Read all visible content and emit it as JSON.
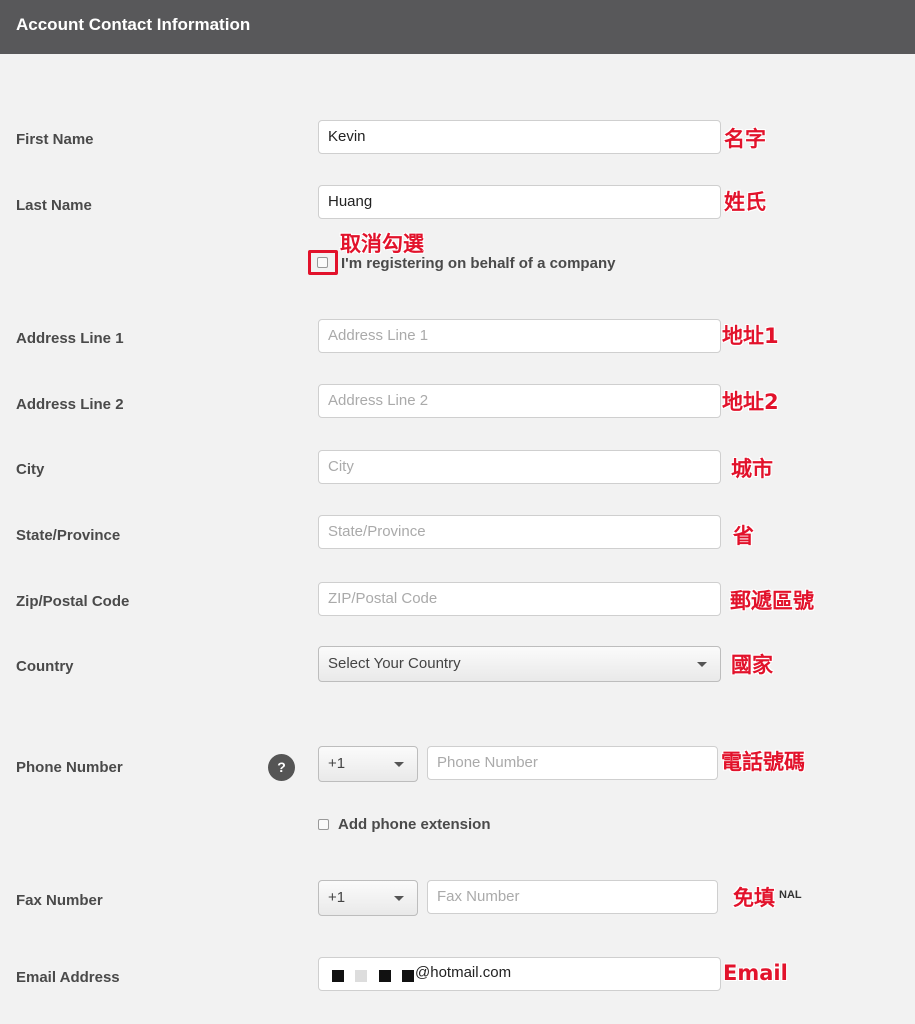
{
  "header": {
    "title": "Account Contact Information"
  },
  "fields": {
    "first_name": {
      "label": "First Name",
      "value": "Kevin",
      "annotation": "名字"
    },
    "last_name": {
      "label": "Last Name",
      "value": "Huang",
      "annotation": "姓氏"
    },
    "company_checkbox": {
      "label": "I'm registering on behalf of a company",
      "annotation": "取消勾選",
      "checked": false
    },
    "address1": {
      "label": "Address Line 1",
      "placeholder": "Address Line 1",
      "annotation": "地址1"
    },
    "address2": {
      "label": "Address Line 2",
      "placeholder": "Address Line 2",
      "annotation": "地址2"
    },
    "city": {
      "label": "City",
      "placeholder": "City",
      "annotation": "城市"
    },
    "state": {
      "label": "State/Province",
      "placeholder": "State/Province",
      "annotation": "省"
    },
    "zip": {
      "label": "Zip/Postal Code",
      "placeholder": "ZIP/Postal Code",
      "annotation": "郵遞區號"
    },
    "country": {
      "label": "Country",
      "selected": "Select Your Country",
      "annotation": "國家"
    },
    "phone": {
      "label": "Phone Number",
      "code": "+1",
      "placeholder": "Phone Number",
      "annotation": "電話號碼",
      "help": "?"
    },
    "phone_ext": {
      "label": "Add phone extension",
      "checked": false
    },
    "fax": {
      "label": "Fax Number",
      "code": "+1",
      "placeholder": "Fax Number",
      "annotation": "免填",
      "annotation_suffix": "NAL"
    },
    "email": {
      "label": "Email Address",
      "value_suffix": "@hotmail.com",
      "annotation": "Email"
    }
  },
  "colors": {
    "header_bg": "#58585a",
    "annotation": "#e2122b",
    "page_bg": "#f2f2f2"
  }
}
